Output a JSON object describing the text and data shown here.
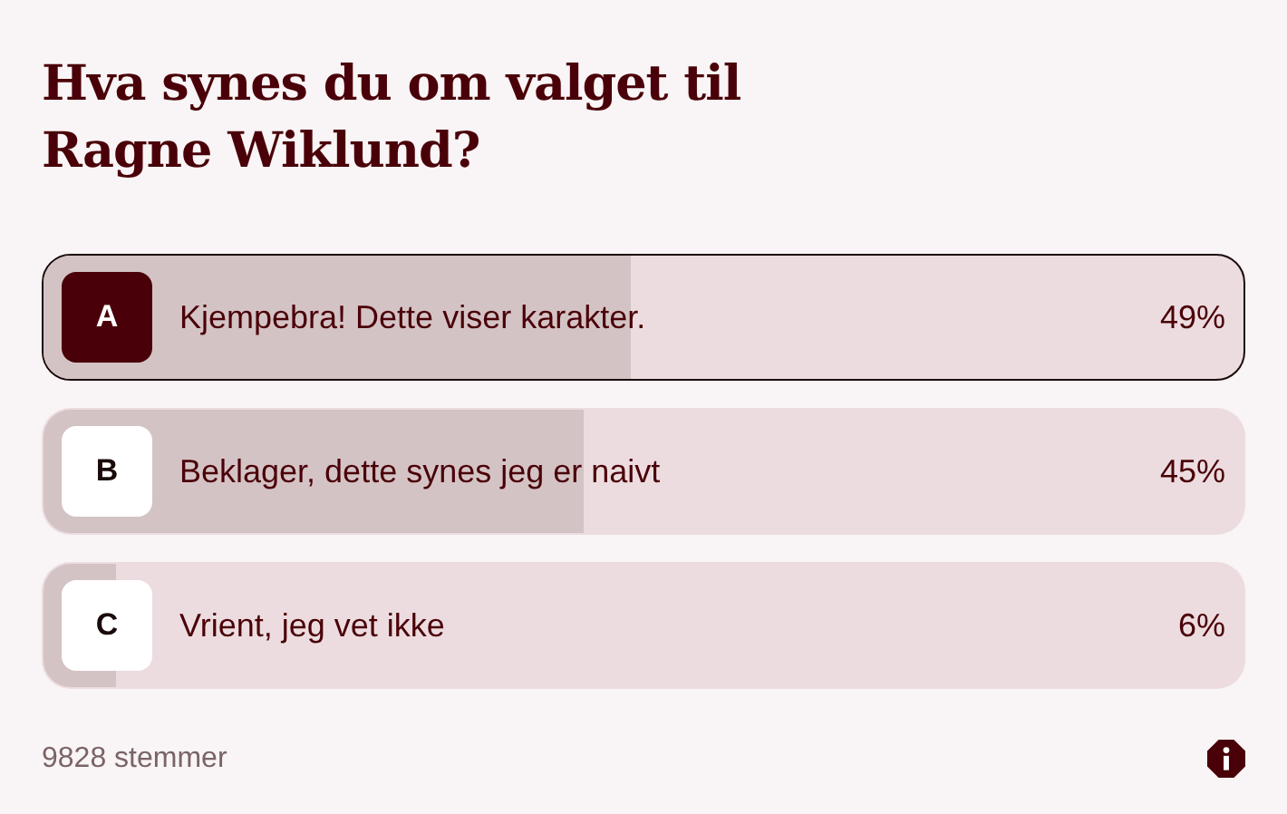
{
  "title": "Hva synes du om valget til Ragne Wiklund?",
  "options": [
    {
      "letter": "A",
      "label": "Kjempebra! Dette viser karakter.",
      "percent": "49%",
      "level": 0.49,
      "selected": true
    },
    {
      "letter": "B",
      "label": "Beklager, dette synes jeg er naivt",
      "percent": "45%",
      "level": 0.45,
      "selected": false
    },
    {
      "letter": "C",
      "label": "Vrient, jeg vet ikke",
      "percent": "6%",
      "level": 0.06,
      "selected": false
    }
  ],
  "votes": "9828 stemmer"
}
